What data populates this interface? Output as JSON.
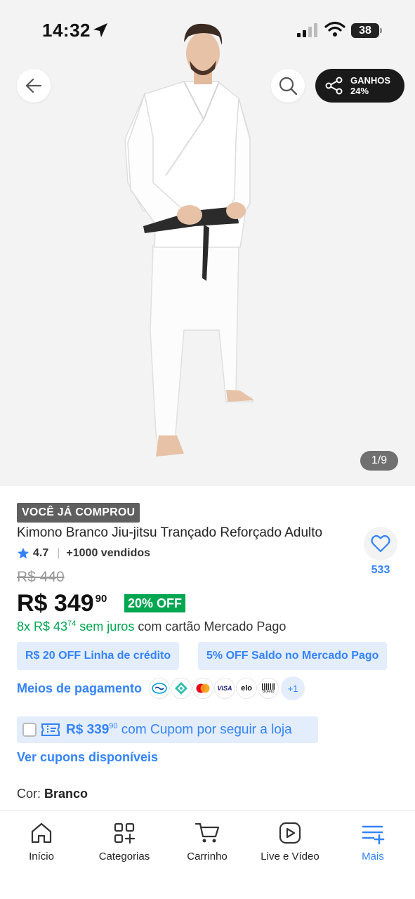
{
  "status_bar": {
    "time": "14:32",
    "battery": "38"
  },
  "header": {
    "share": {
      "label_line1": "GANHOS",
      "label_line2": "24%"
    },
    "pager": "1/9"
  },
  "product": {
    "purchased_badge": "VOCÊ JÁ COMPROU",
    "title": "Kimono Branco Jiu-jitsu Trançado Reforçado Adulto",
    "rating": "4.7",
    "sold": "+1000 vendidos",
    "favorites_count": "533",
    "old_price": "R$ 440",
    "price_main": "R$ 349",
    "price_cents": "90",
    "discount": "20% OFF",
    "installments": {
      "prefix": "8x R$ 43",
      "cents": "74",
      "suffix_green": " sem juros",
      "suffix": " com cartão Mercado Pago"
    },
    "promo_chips": [
      "R$ 20 OFF Linha de crédito",
      "5% OFF Saldo no Mercado Pago"
    ],
    "payment_methods": {
      "label": "Meios de pagamento",
      "icons": [
        "mercado-pago-icon",
        "pix-icon",
        "mastercard-icon",
        "visa-icon",
        "elo-icon",
        "boleto-icon"
      ],
      "visa": "VISA",
      "elo": "elo",
      "boleto": "Boleto",
      "more": "+1"
    },
    "coupon": {
      "price": "R$ 339",
      "cents": "90",
      "text": " com Cupom por seguir a loja"
    },
    "coupons_link": "Ver cupons disponíveis",
    "color_label": "Cor: ",
    "color_value": "Branco"
  },
  "bottom_nav": [
    {
      "label": "Início",
      "icon": "home-icon"
    },
    {
      "label": "Categorias",
      "icon": "categories-icon"
    },
    {
      "label": "Carrinho",
      "icon": "cart-icon"
    },
    {
      "label": "Live e Vídeo",
      "icon": "video-icon"
    },
    {
      "label": "Mais",
      "icon": "menu-plus-icon"
    }
  ],
  "colors": {
    "accent": "#3483fa",
    "discount_green": "#00a650",
    "chip_bg": "#e3edfb"
  }
}
